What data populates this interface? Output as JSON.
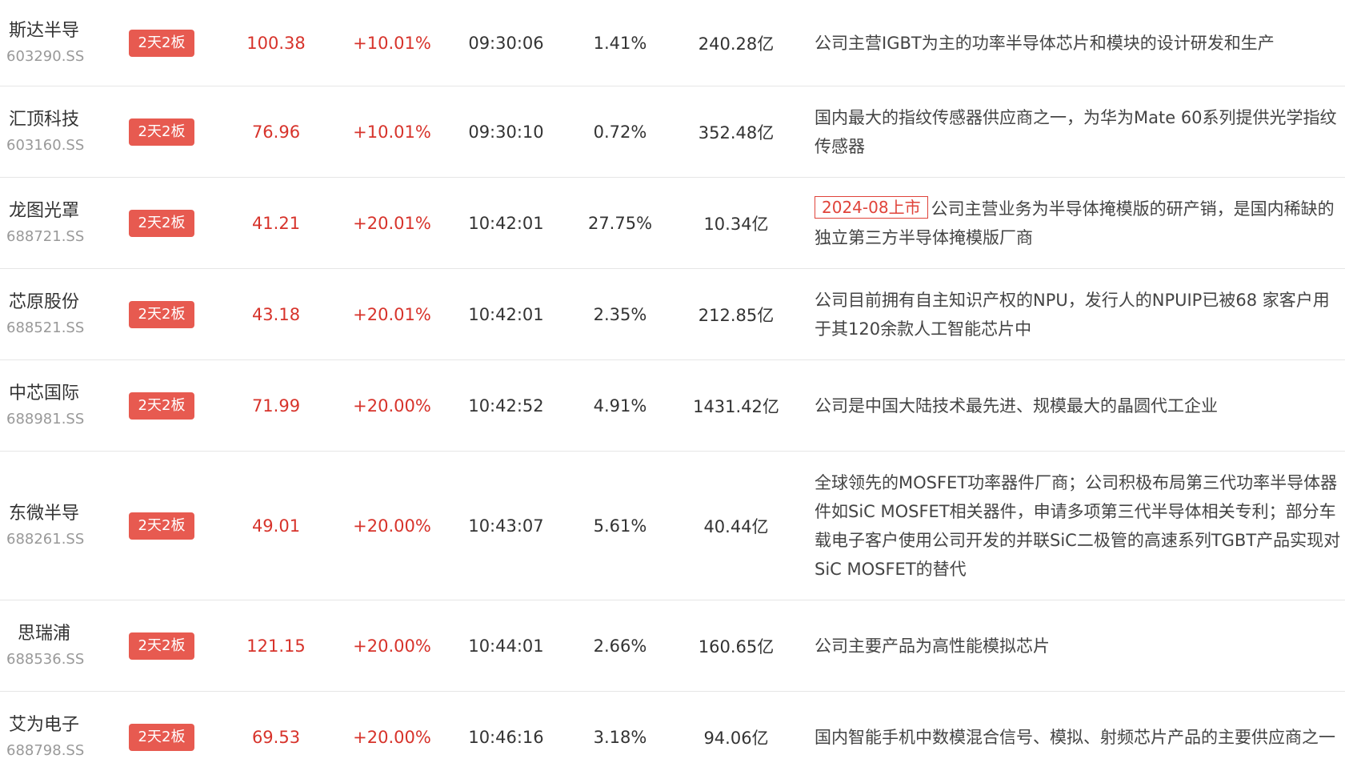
{
  "rows": [
    {
      "name": "斯达半导",
      "code": "603290.SS",
      "badge": "2天2板",
      "price": "100.38",
      "change": "+10.01%",
      "time": "09:30:06",
      "turnover": "1.41%",
      "market_cap": "240.28亿",
      "tag": "",
      "desc": "公司主营IGBT为主的功率半导体芯片和模块的设计研发和生产"
    },
    {
      "name": "汇顶科技",
      "code": "603160.SS",
      "badge": "2天2板",
      "price": "76.96",
      "change": "+10.01%",
      "time": "09:30:10",
      "turnover": "0.72%",
      "market_cap": "352.48亿",
      "tag": "",
      "desc": "国内最大的指纹传感器供应商之一，为华为Mate 60系列提供光学指纹传感器"
    },
    {
      "name": "龙图光罩",
      "code": "688721.SS",
      "badge": "2天2板",
      "price": "41.21",
      "change": "+20.01%",
      "time": "10:42:01",
      "turnover": "27.75%",
      "market_cap": "10.34亿",
      "tag": "2024-08上市",
      "desc": "公司主营业务为半导体掩模版的研产销，是国内稀缺的独立第三方半导体掩模版厂商"
    },
    {
      "name": "芯原股份",
      "code": "688521.SS",
      "badge": "2天2板",
      "price": "43.18",
      "change": "+20.01%",
      "time": "10:42:01",
      "turnover": "2.35%",
      "market_cap": "212.85亿",
      "tag": "",
      "desc": "公司目前拥有自主知识产权的NPU，发行人的NPUIP已被68 家客户用于其120余款人工智能芯片中"
    },
    {
      "name": "中芯国际",
      "code": "688981.SS",
      "badge": "2天2板",
      "price": "71.99",
      "change": "+20.00%",
      "time": "10:42:52",
      "turnover": "4.91%",
      "market_cap": "1431.42亿",
      "tag": "",
      "desc": "公司是中国大陆技术最先进、规模最大的晶圆代工企业"
    },
    {
      "name": "东微半导",
      "code": "688261.SS",
      "badge": "2天2板",
      "price": "49.01",
      "change": "+20.00%",
      "time": "10:43:07",
      "turnover": "5.61%",
      "market_cap": "40.44亿",
      "tag": "",
      "desc": "全球领先的MOSFET功率器件厂商；公司积极布局第三代功率半导体器件如SiC MOSFET相关器件，申请多项第三代半导体相关专利；部分车载电子客户使用公司开发的并联SiC二极管的高速系列TGBT产品实现对SiC MOSFET的替代"
    },
    {
      "name": "思瑞浦",
      "code": "688536.SS",
      "badge": "2天2板",
      "price": "121.15",
      "change": "+20.00%",
      "time": "10:44:01",
      "turnover": "2.66%",
      "market_cap": "160.65亿",
      "tag": "",
      "desc": "公司主要产品为高性能模拟芯片"
    },
    {
      "name": "艾为电子",
      "code": "688798.SS",
      "badge": "2天2板",
      "price": "69.53",
      "change": "+20.00%",
      "time": "10:46:16",
      "turnover": "3.18%",
      "market_cap": "94.06亿",
      "tag": "",
      "desc": "国内智能手机中数模混合信号、模拟、射频芯片产品的主要供应商之一"
    }
  ]
}
